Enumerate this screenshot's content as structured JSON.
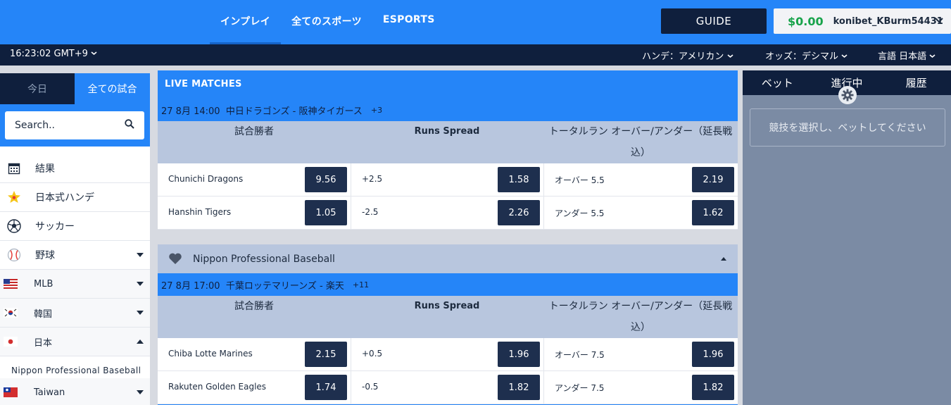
{
  "topnav": {
    "items": [
      "インプレイ",
      "全てのスポーツ",
      "ESPORTS"
    ]
  },
  "header": {
    "guide_label": "GUIDE",
    "balance": "$0.00",
    "username": "konibet_KBurm54431"
  },
  "subbar": {
    "clock": "16:23:02 GMT+9",
    "handicap_label": "ハンデ：",
    "handicap_value": "アメリカン",
    "odds_label": "オッズ：",
    "odds_value": "デシマル",
    "language_label": "言語",
    "language_value": "日本語"
  },
  "sidebar": {
    "tabs": [
      "今日",
      "全ての試合"
    ],
    "search_placeholder": "Search..",
    "items": [
      {
        "label": "結果",
        "icon": "calendar-icon"
      },
      {
        "label": "日本式ハンデ",
        "icon": "star-icon"
      },
      {
        "label": "サッカー",
        "icon": "soccer-ball-icon"
      },
      {
        "label": "野球",
        "icon": "baseball-icon"
      },
      {
        "label": "MLB",
        "icon": "us-flag-icon"
      },
      {
        "label": "韓国",
        "icon": "korea-flag-icon"
      },
      {
        "label": "日本",
        "icon": "japan-flag-icon"
      },
      {
        "label": "Nippon Professional Baseball"
      },
      {
        "label": "Taiwan",
        "icon": "taiwan-flag-icon"
      }
    ]
  },
  "main": {
    "live_title": "LIVE MATCHES",
    "col_headers": {
      "winner": "試合勝者",
      "spread": "Runs Spread",
      "total_line1": "トータルラン オーバー/アンダー（延長戦",
      "total_line2": "込）"
    },
    "league_name": "Nippon Professional Baseball",
    "matches": [
      {
        "datetime": "27 8月 14:00",
        "title": "中日ドラゴンズ - 阪神タイガース",
        "extra": "+3",
        "rows": [
          {
            "team": "Chunichi Dragons",
            "win": "9.56",
            "spread": "+2.5",
            "spread_odd": "1.58",
            "ou": "オーバー 5.5",
            "ou_odd": "2.19"
          },
          {
            "team": "Hanshin Tigers",
            "win": "1.05",
            "spread": "-2.5",
            "spread_odd": "2.26",
            "ou": "アンダー 5.5",
            "ou_odd": "1.62"
          }
        ]
      },
      {
        "datetime": "27 8月 17:00",
        "title": "千葉ロッテマリーンズ - 楽天",
        "extra": "+11",
        "rows": [
          {
            "team": "Chiba Lotte Marines",
            "win": "2.15",
            "spread": "+0.5",
            "spread_odd": "1.96",
            "ou": "オーバー 7.5",
            "ou_odd": "1.96"
          },
          {
            "team": "Rakuten Golden Eagles",
            "win": "1.74",
            "spread": "-0.5",
            "spread_odd": "1.82",
            "ou": "アンダー 7.5",
            "ou_odd": "1.82"
          }
        ]
      }
    ]
  },
  "betslip": {
    "tabs": [
      "ベット",
      "進行中",
      "履歴"
    ],
    "message": "競技を選択し、ベットしてください"
  },
  "colors": {
    "brand_blue": "#2585f8",
    "navy": "#0f1f3d",
    "odds_button": "#1e2f4e",
    "balance_green": "#17a34a"
  }
}
